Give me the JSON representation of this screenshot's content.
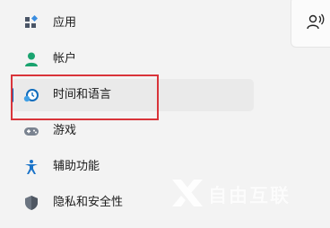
{
  "sidebar": {
    "items": [
      {
        "label": "应用",
        "icon": "apps-icon"
      },
      {
        "label": "帐户",
        "icon": "account-icon"
      },
      {
        "label": "时间和语言",
        "icon": "time-language-icon",
        "selected": true
      },
      {
        "label": "游戏",
        "icon": "gaming-icon"
      },
      {
        "label": "辅助功能",
        "icon": "accessibility-icon"
      },
      {
        "label": "隐私和安全性",
        "icon": "privacy-shield-icon"
      }
    ]
  },
  "right_panel": {
    "icon": "voice-activity-icon"
  },
  "watermark": {
    "text": "自由互联",
    "logo": "x-logo-icon"
  },
  "colors": {
    "accent": "#0067c0",
    "highlight_box": "#d9343a",
    "background": "#f3f3f3",
    "selected_bg": "#eaeaea"
  }
}
